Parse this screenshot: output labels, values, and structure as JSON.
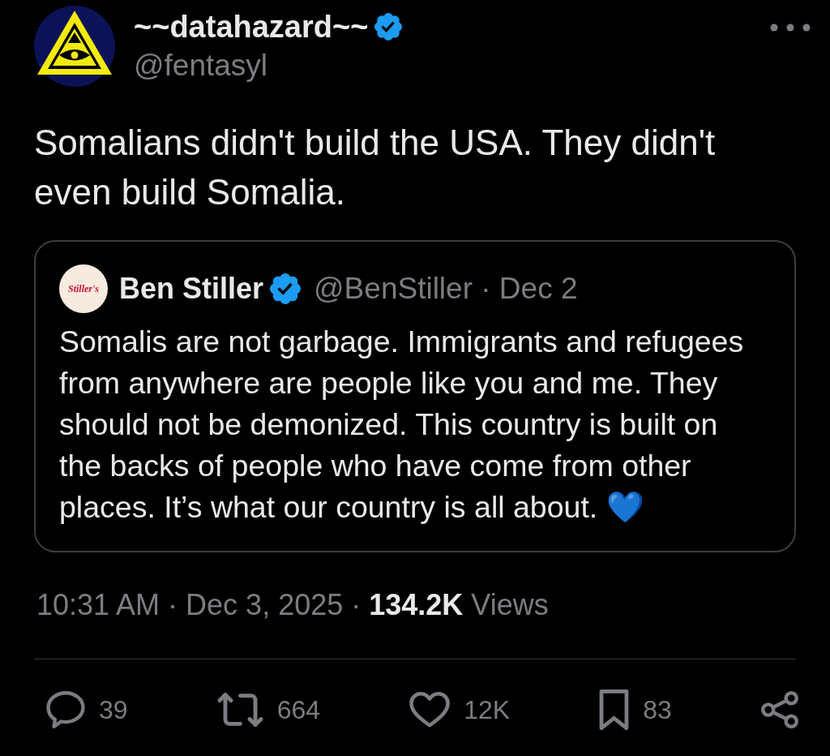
{
  "author": {
    "name": "~~datahazard~~",
    "handle": "@fentasyl",
    "verified": true
  },
  "text": "Somalians didn't build the USA. They didn't even build Somalia.",
  "quoted_tweet": {
    "avatar_text": "Stiller's",
    "name": "Ben Stiller",
    "verified": true,
    "byline": "@BenStiller · Dec 2",
    "text": "Somalis are not garbage. Immigrants and refugees from anywhere are people like you and me. They should not be demonized. This country is built on the backs of people who have come from other places. It’s what our country is all about. 💙"
  },
  "meta": "10:31 AM · Dec 3, 2025 · **134.2K** Views",
  "actions": [
    {
      "kind": "reply",
      "count": "39"
    },
    {
      "kind": "repost",
      "count": "664"
    },
    {
      "kind": "like",
      "count": "12K"
    },
    {
      "kind": "bookmark",
      "count": "83"
    },
    {
      "kind": "share"
    }
  ]
}
